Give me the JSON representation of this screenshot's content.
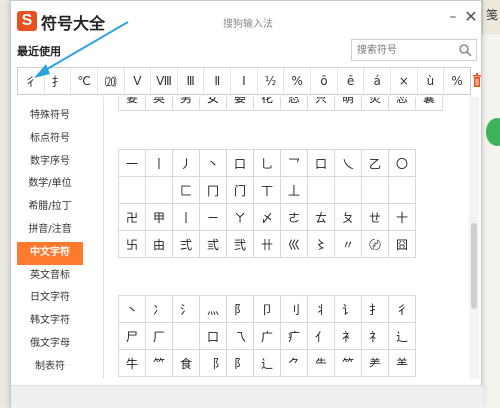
{
  "background": {
    "right_tab_char": "笺"
  },
  "window": {
    "logo_letter": "S",
    "app_title": "符号大全",
    "title": "搜狗输入法",
    "min_glyph": "–",
    "close_glyph": "✕"
  },
  "recent": {
    "label": "最近使用",
    "symbols": [
      "彳",
      "扌",
      "℃",
      "⒇",
      "Ⅴ",
      "Ⅷ",
      "Ⅲ",
      "Ⅱ",
      "Ⅰ",
      "½",
      "%",
      "ō",
      "ē",
      "á",
      "×",
      "ù",
      "%"
    ]
  },
  "search": {
    "placeholder": "搜索符号"
  },
  "sidebar": {
    "items": [
      {
        "label": "特殊符号"
      },
      {
        "label": "标点符号"
      },
      {
        "label": "数字序号"
      },
      {
        "label": "数学/单位"
      },
      {
        "label": "希腊/拉丁"
      },
      {
        "label": "拼音/注音"
      },
      {
        "label": "中文字符",
        "active": true
      },
      {
        "label": "英文音标"
      },
      {
        "label": "日文字符"
      },
      {
        "label": "韩文字符"
      },
      {
        "label": "俄文字母"
      },
      {
        "label": "制表符"
      }
    ]
  },
  "grid_top": [
    [
      "要",
      "奥",
      "男",
      "女",
      "晏",
      "花",
      "忍",
      "只",
      "萌",
      "炎",
      "恋",
      "囊"
    ]
  ],
  "grid_a": [
    [
      "一",
      "丨",
      "丿",
      "丶",
      "口",
      "乚",
      "乛",
      "口",
      "乀",
      "乙",
      "〇"
    ],
    [
      "",
      "",
      "匚",
      "冂",
      "门",
      "丅",
      "丄",
      "",
      "",
      "",
      ""
    ],
    [
      "卍",
      "甲",
      "丨",
      "ㄧ",
      "ㄚ",
      "〆",
      "ㄜ",
      "ㄊ",
      "ㄆ",
      "ㄝ",
      "十"
    ],
    [
      "卐",
      "由",
      "弍",
      "弎",
      "弐",
      "卄",
      "巛",
      "〻",
      "〃",
      "〄",
      "囧"
    ]
  ],
  "grid_b": [
    [
      "丶",
      "冫",
      "氵",
      "灬",
      "阝",
      "卩",
      "刂",
      "丬",
      "讠",
      "扌",
      "彳"
    ],
    [
      "尸",
      "厂",
      "",
      "口",
      "乁",
      "广",
      "疒",
      "亻",
      "衤",
      "礻",
      "辶"
    ],
    [
      "牛",
      "⺮",
      "食",
      "⻏",
      "⻖",
      "⻌",
      "⺈",
      "⺧",
      "⺮",
      "⺶",
      "⺷"
    ]
  ],
  "colors": {
    "brand": "#e8501f",
    "active_tab": "#ff7a2e",
    "arrow": "#2ea2e0"
  }
}
